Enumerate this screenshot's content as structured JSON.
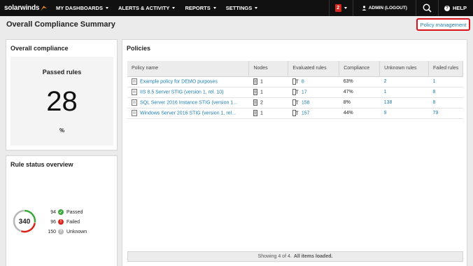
{
  "nav": {
    "brand": "solarwinds",
    "items": [
      "MY DASHBOARDS",
      "ALERTS & ACTIVITY",
      "REPORTS",
      "SETTINGS"
    ],
    "notification_count": "2",
    "admin_label": "ADMIN (LOGOUT)",
    "help_label": "HELP"
  },
  "page": {
    "title": "Overall Compliance Summary",
    "policy_management_link": "Policy management"
  },
  "overall_compliance": {
    "title": "Overall compliance",
    "label": "Passed rules",
    "value": "28",
    "unit": "%"
  },
  "rule_status": {
    "title": "Rule status overview",
    "total": "340",
    "items": [
      {
        "count": "94",
        "label": "Passed",
        "color": "#3aa83a"
      },
      {
        "count": "96",
        "label": "Failed",
        "color": "#d9261c"
      },
      {
        "count": "150",
        "label": "Unknown",
        "color": "#b8b8b8"
      }
    ]
  },
  "policies": {
    "title": "Policies",
    "columns": [
      "Policy name",
      "Nodes",
      "Evaluated rules",
      "Compliance",
      "Unknown rules",
      "Failed rules"
    ],
    "rows": [
      {
        "name": "Example policy for DEMO purposes",
        "nodes": "1",
        "evaluated": "8",
        "compliance": "63%",
        "unknown": "2",
        "failed": "1"
      },
      {
        "name": "IIS 8.5 Server STIG (version 1, rel. 10)",
        "nodes": "1",
        "evaluated": "17",
        "compliance": "47%",
        "unknown": "1",
        "failed": "8"
      },
      {
        "name": "SQL Server 2016 Instance STIG (version 1...",
        "nodes": "2",
        "evaluated": "158",
        "compliance": "8%",
        "unknown": "138",
        "failed": "8"
      },
      {
        "name": "Windows Server 2016 STIG (version 1, rel...",
        "nodes": "1",
        "evaluated": "157",
        "compliance": "44%",
        "unknown": "9",
        "failed": "79"
      }
    ],
    "footer_text": "Showing 4 of 4.",
    "footer_bold": "All items loaded."
  }
}
